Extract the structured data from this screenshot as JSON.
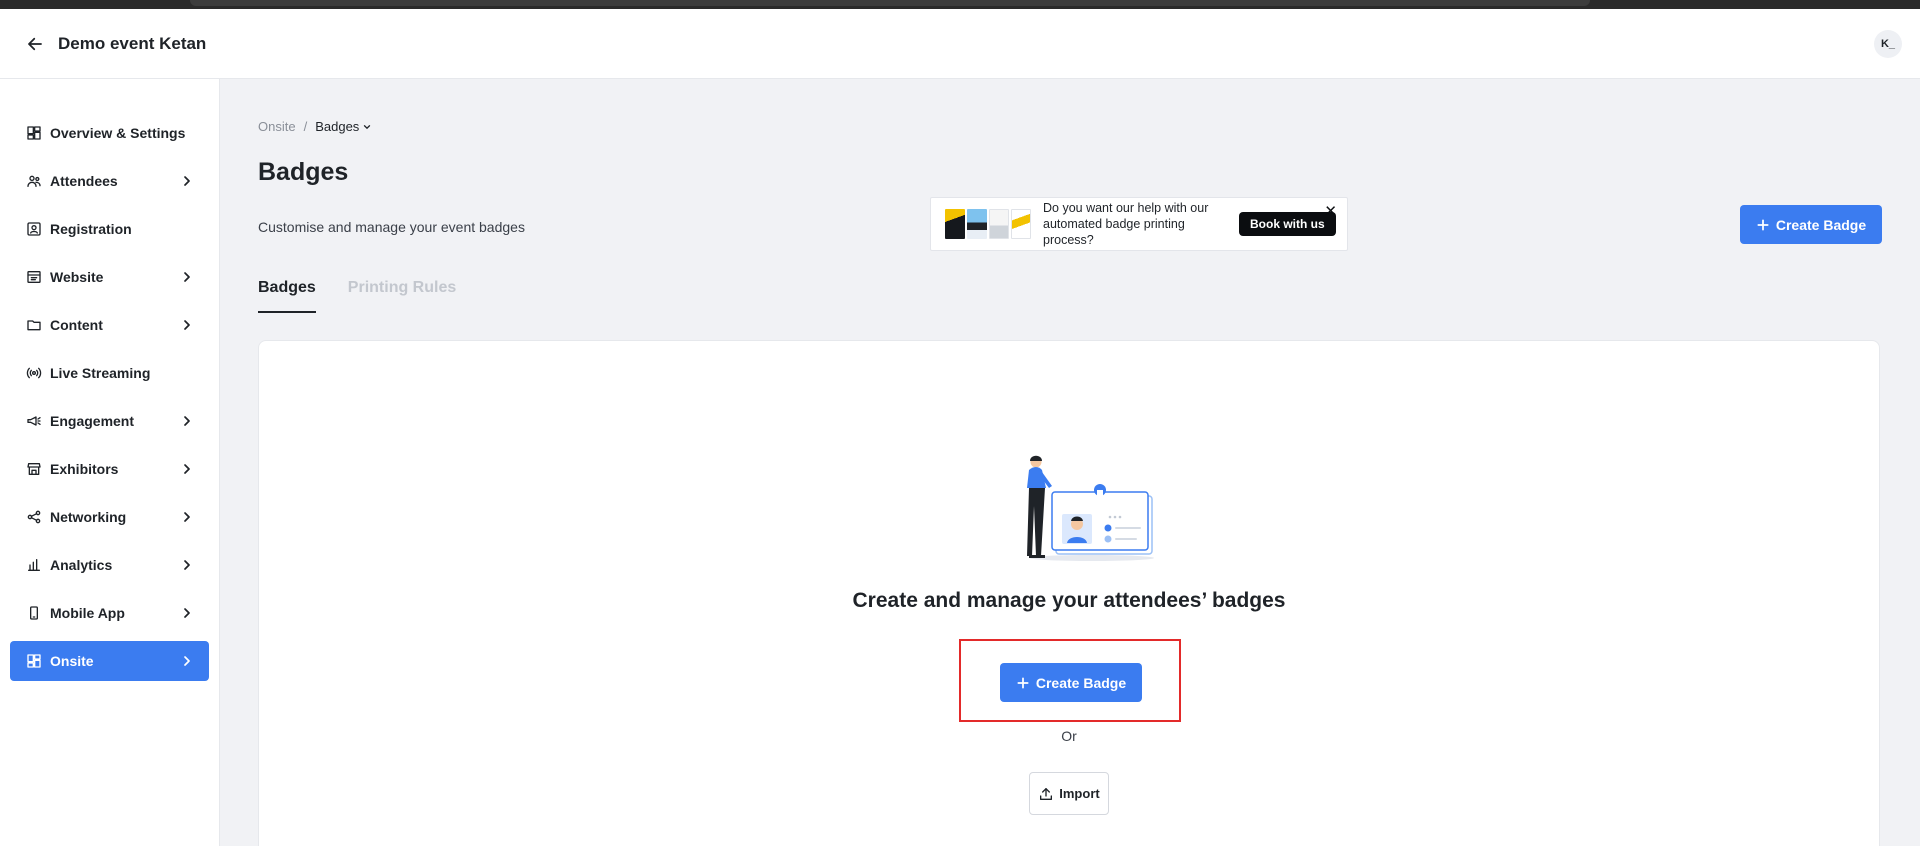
{
  "header": {
    "title": "Demo event Ketan",
    "avatar_initials": "K_"
  },
  "sidebar": {
    "items": [
      {
        "label": "Overview & Settings",
        "icon": "dashboard-icon",
        "has_submenu": false
      },
      {
        "label": "Attendees",
        "icon": "people-icon",
        "has_submenu": true
      },
      {
        "label": "Registration",
        "icon": "id-card-icon",
        "has_submenu": false
      },
      {
        "label": "Website",
        "icon": "browser-window-icon",
        "has_submenu": true
      },
      {
        "label": "Content",
        "icon": "folder-icon",
        "has_submenu": true
      },
      {
        "label": "Live Streaming",
        "icon": "broadcast-icon",
        "has_submenu": false
      },
      {
        "label": "Engagement",
        "icon": "megaphone-icon",
        "has_submenu": true
      },
      {
        "label": "Exhibitors",
        "icon": "storefront-icon",
        "has_submenu": true
      },
      {
        "label": "Networking",
        "icon": "share-nodes-icon",
        "has_submenu": true
      },
      {
        "label": "Analytics",
        "icon": "bar-chart-icon",
        "has_submenu": true
      },
      {
        "label": "Mobile App",
        "icon": "mobile-phone-icon",
        "has_submenu": true
      },
      {
        "label": "Onsite",
        "icon": "dashboard-icon",
        "has_submenu": true,
        "active": true
      }
    ]
  },
  "breadcrumb": {
    "parent": "Onsite",
    "separator": "/",
    "current": "Badges"
  },
  "page": {
    "title": "Badges",
    "subtitle": "Customise and manage your event badges"
  },
  "promo": {
    "text": "Do you want our help with our automated badge printing process?",
    "cta_label": "Book with us",
    "close_glyph": "✕"
  },
  "actions": {
    "create_badge_label": "Create Badge",
    "import_label": "Import"
  },
  "tabs": [
    {
      "label": "Badges",
      "active": true
    },
    {
      "label": "Printing Rules",
      "active": false
    }
  ],
  "empty_state": {
    "title": "Create and manage your attendees’ badges",
    "or_text": "Or"
  },
  "colors": {
    "accent": "#3b7cf0",
    "highlight_border": "#e32a2a",
    "page_bg": "#f1f2f5",
    "dark_button": "#0b0d10"
  }
}
